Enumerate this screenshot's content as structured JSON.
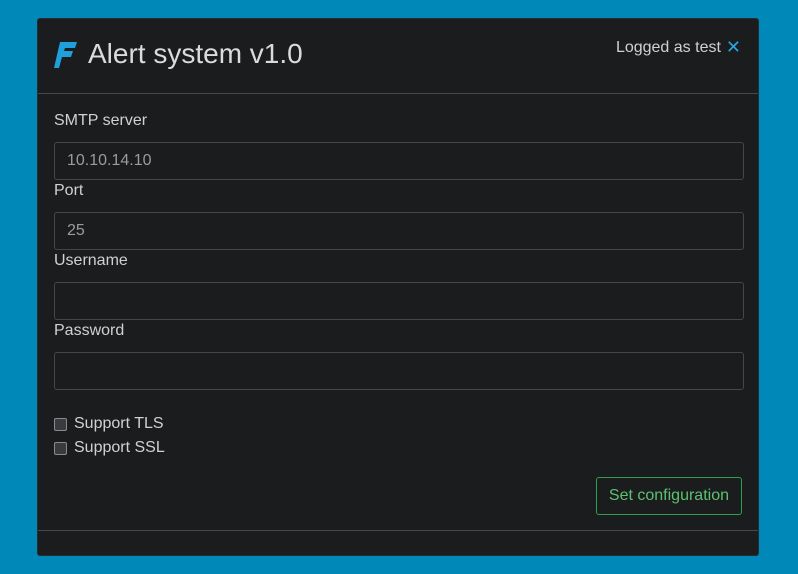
{
  "header": {
    "title": "Alert system v1.0",
    "user_text": "Logged as test",
    "close_symbol": "✕",
    "logo_icon": "brand-logo-icon"
  },
  "form": {
    "smtp_label": "SMTP server",
    "smtp_value": "10.10.14.10",
    "port_label": "Port",
    "port_value": "25",
    "username_label": "Username",
    "username_value": "",
    "password_label": "Password",
    "password_value": "",
    "tls_label": "Support TLS",
    "tls_checked": false,
    "ssl_label": "Support SSL",
    "ssl_checked": false,
    "submit_label": "Set configuration"
  },
  "colors": {
    "background": "#0088b8",
    "card": "#1b1c1e",
    "accent": "#2aa3e0",
    "success": "#5cc170"
  }
}
